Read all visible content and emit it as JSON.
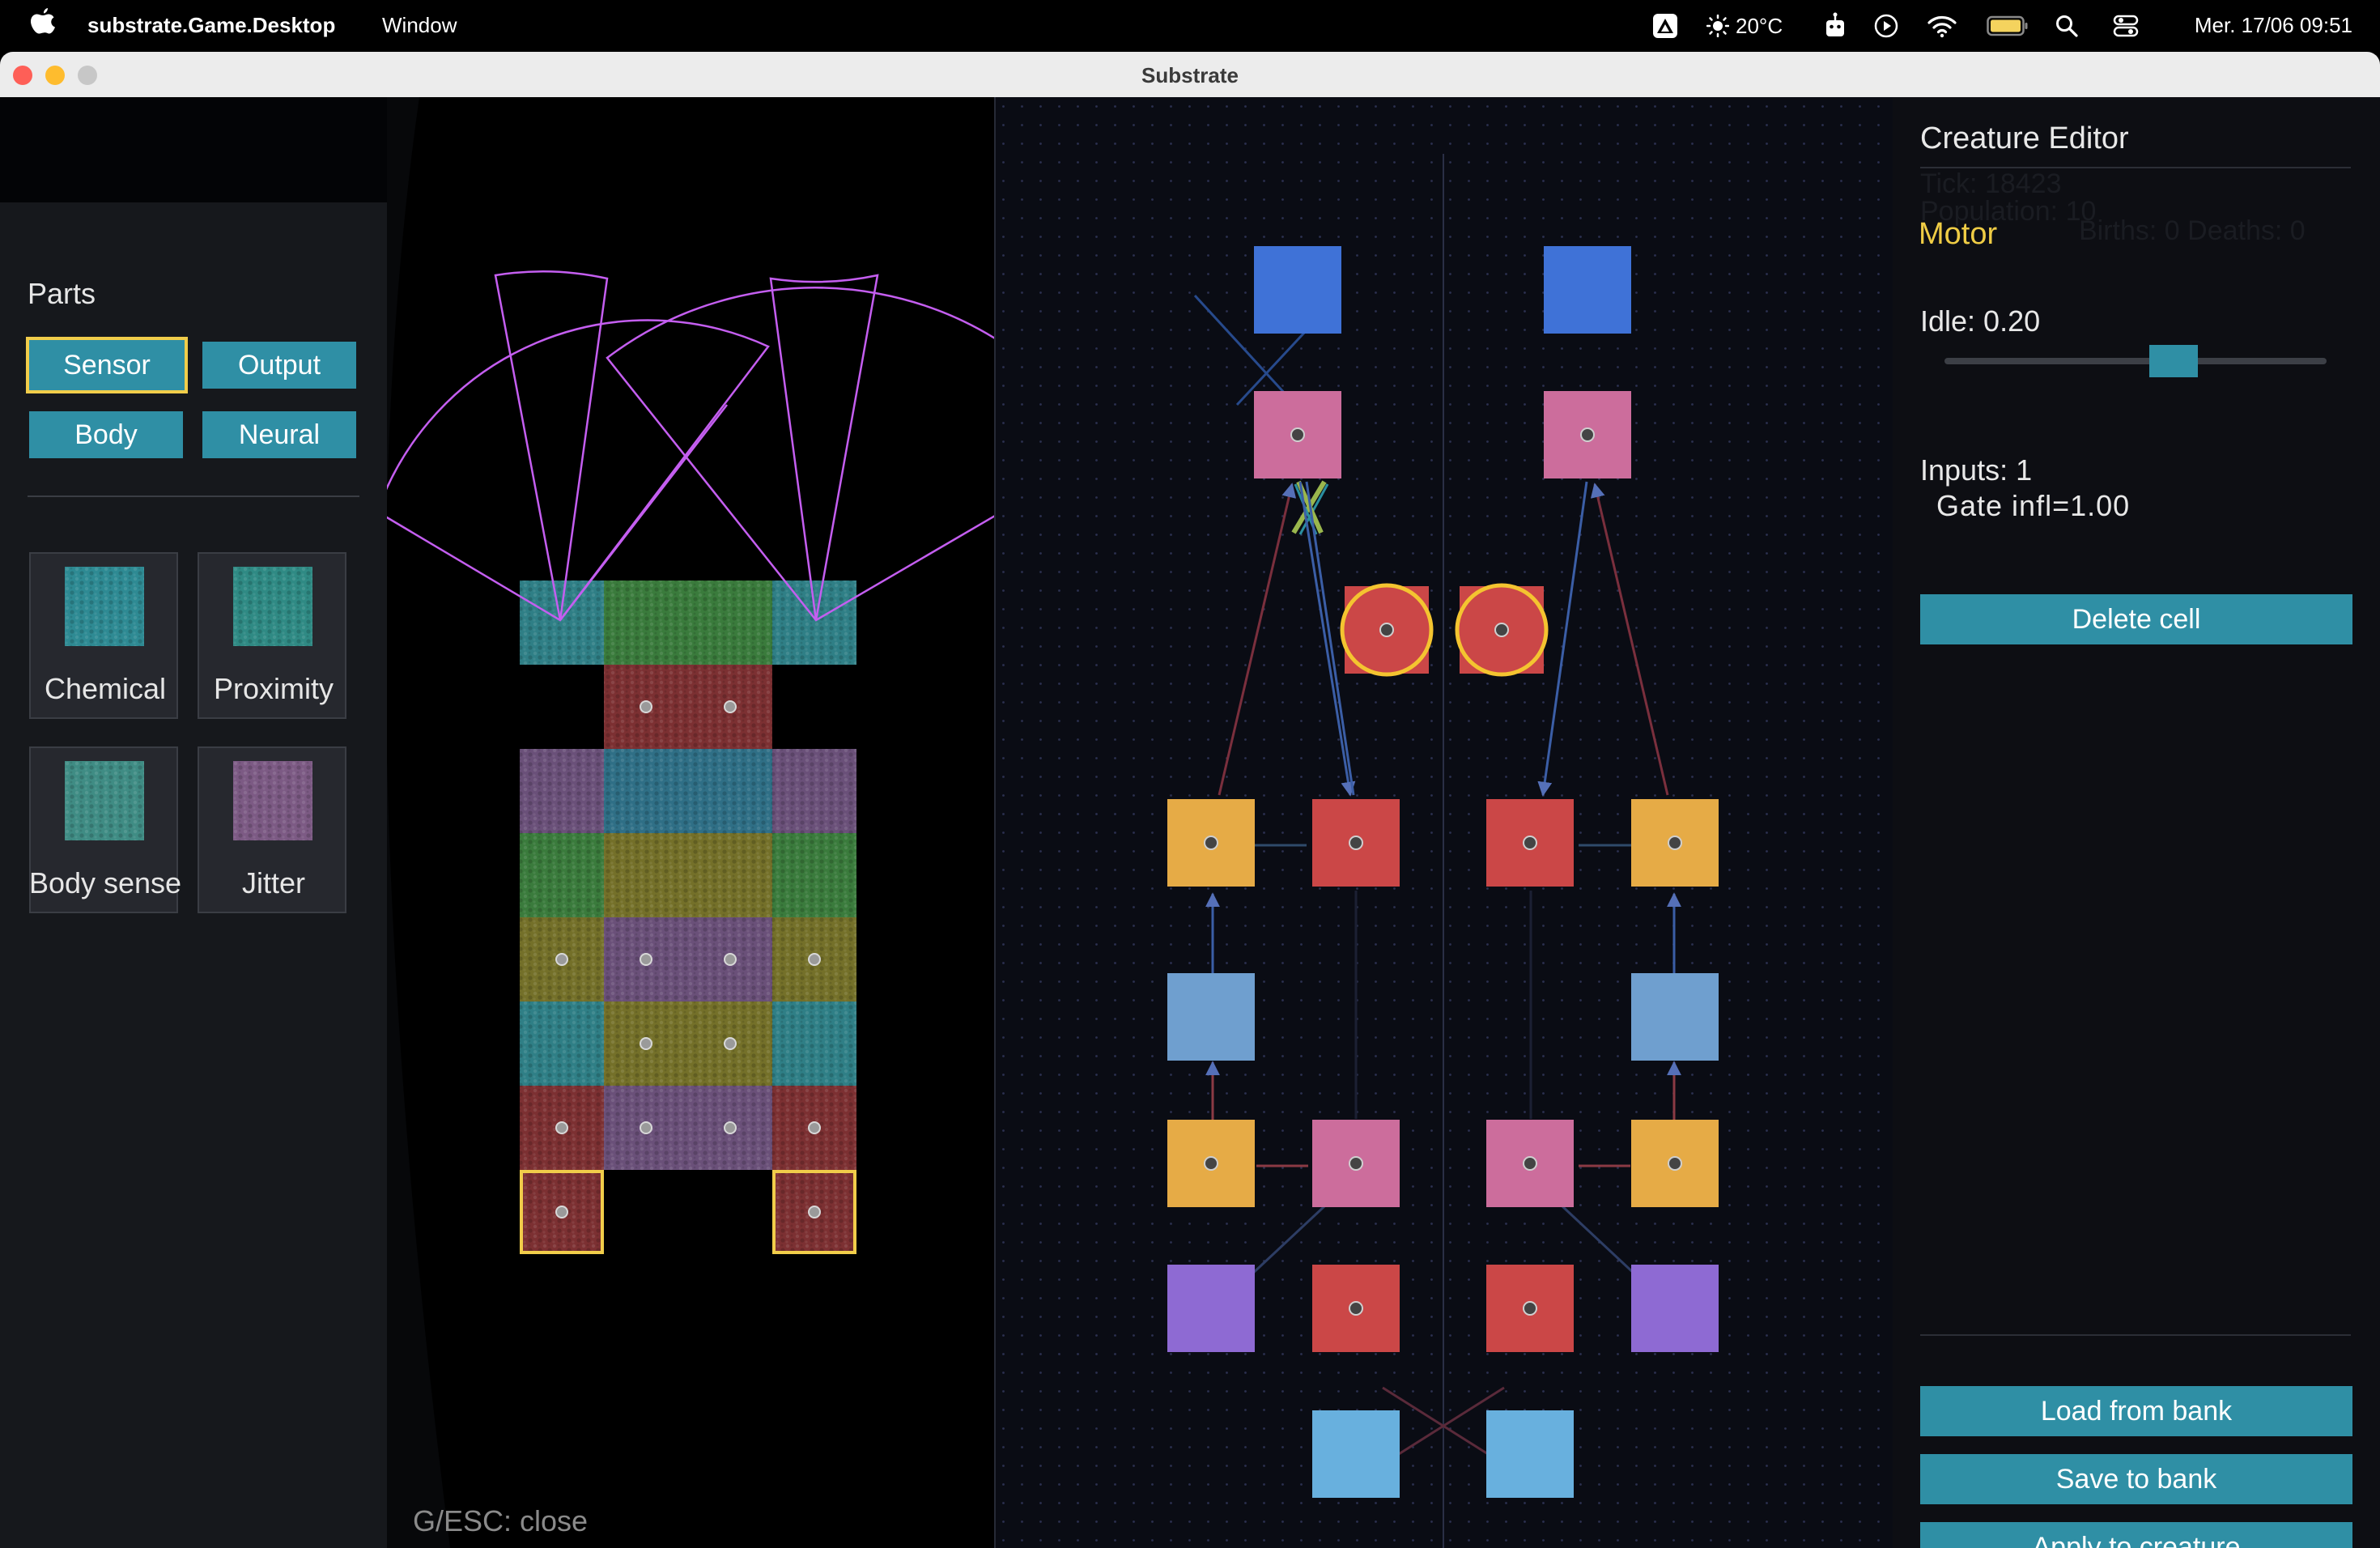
{
  "menubar": {
    "app_name": "substrate.Game.Desktop",
    "menu_window": "Window",
    "weather": "20°C",
    "clock": "Mer. 17/06  09:51"
  },
  "window": {
    "title": "Substrate"
  },
  "parts": {
    "title": "Parts",
    "categories": [
      {
        "label": "Sensor",
        "selected": true
      },
      {
        "label": "Output",
        "selected": false
      },
      {
        "label": "Body",
        "selected": false
      },
      {
        "label": "Neural",
        "selected": false
      }
    ],
    "items": [
      {
        "label": "Chemical",
        "color": "#2e8a93"
      },
      {
        "label": "Proximity",
        "color": "#2f8a84"
      },
      {
        "label": "Body sense",
        "color": "#3f8c84"
      },
      {
        "label": "Jitter",
        "color": "#7c5a84"
      }
    ]
  },
  "creature": {
    "close_hint": "G/ESC: close",
    "palette": {
      "T": "#2f7f86",
      "G": "#3a7b3c",
      "R": "#7c3032",
      "P": "#6a5079",
      "Y": "#747029",
      "Tp": "#2f6f86"
    },
    "rows": [
      [
        "T",
        "G",
        "G",
        "T"
      ],
      [
        null,
        "R",
        "R",
        null
      ],
      [
        "P",
        "Tp",
        "Tp",
        "P"
      ],
      [
        "G",
        "Y",
        "Y",
        "G"
      ],
      [
        "Y",
        "P",
        "P",
        "Y"
      ],
      [
        "T",
        "Y",
        "Y",
        "T"
      ],
      [
        "R",
        "P",
        "P",
        "R"
      ],
      [
        "R",
        null,
        null,
        "R"
      ]
    ],
    "dots": [
      [
        1,
        1
      ],
      [
        1,
        2
      ],
      [
        4,
        0
      ],
      [
        4,
        1
      ],
      [
        4,
        2
      ],
      [
        4,
        3
      ],
      [
        5,
        1
      ],
      [
        5,
        2
      ],
      [
        6,
        0
      ],
      [
        6,
        1
      ],
      [
        6,
        2
      ],
      [
        6,
        3
      ],
      [
        7,
        0
      ],
      [
        7,
        3
      ]
    ],
    "highlighted": [
      [
        7,
        0
      ],
      [
        7,
        3
      ]
    ],
    "accent_sensor_arc": "#c45ef0",
    "accent_selected": "#f1cd4a"
  },
  "neural": {
    "colors": {
      "blue": "#3f72d7",
      "pink": "#cc6d9c",
      "red": "#cb4747",
      "orange": "#e6ab46",
      "steel": "#6f9fcf",
      "purple": "#8e6ad3",
      "sky": "#68b0de",
      "selected": "#f4c430"
    }
  },
  "editor": {
    "title": "Creature Editor",
    "ghost_lines": [
      "Tick: 18423",
      "Population: 10",
      "Births: 0   Deaths: 0"
    ],
    "selected_type": "Motor",
    "idle_label": "Idle: 0.20",
    "idle_value": 0.6,
    "inputs_label": "Inputs: 1",
    "gate_label": "Gate  infl=1.00",
    "delete_label": "Delete cell",
    "load_label": "Load from bank",
    "save_label": "Save to bank",
    "apply_label": "Apply to creature"
  }
}
